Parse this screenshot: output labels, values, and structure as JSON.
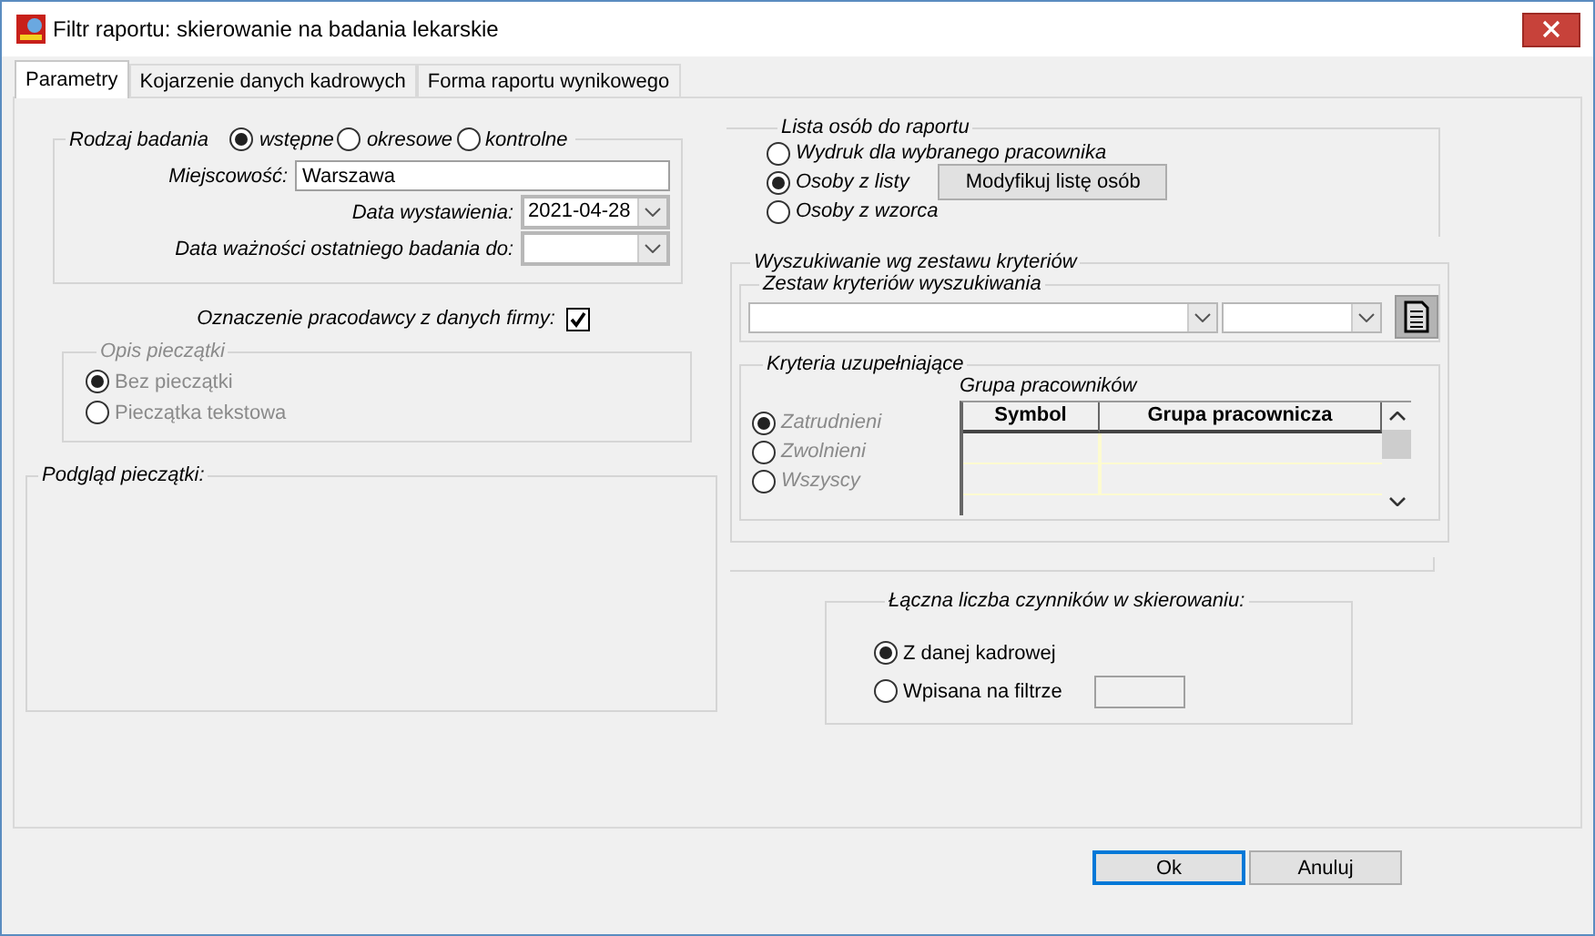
{
  "window": {
    "title": "Filtr raportu: skierowanie na badania lekarskie"
  },
  "tabs": [
    {
      "label": "Parametry",
      "selected": true
    },
    {
      "label": "Kojarzenie danych kadrowych",
      "selected": false
    },
    {
      "label": "Forma raportu wynikowego",
      "selected": false
    }
  ],
  "exam_type": {
    "label": "Rodzaj badania",
    "options": [
      {
        "label": "wstępne",
        "selected": true
      },
      {
        "label": "okresowe",
        "selected": false
      },
      {
        "label": "kontrolne",
        "selected": false
      }
    ]
  },
  "location": {
    "label": "Miejscowość:",
    "value": "Warszawa"
  },
  "issue_date": {
    "label": "Data wystawienia:",
    "value": "2021-04-28"
  },
  "validity_date": {
    "label": "Data ważności ostatniego badania do:"
  },
  "employer_mark": {
    "label": "Oznaczenie pracodawcy z danych firmy:",
    "checked": true
  },
  "stamp_description": {
    "title": "Opis pieczątki",
    "disabled": true,
    "options": [
      {
        "label": "Bez pieczątki",
        "selected": true
      },
      {
        "label": "Pieczątka tekstowa",
        "selected": false
      }
    ]
  },
  "stamp_preview": {
    "title": "Podgląd pieczątki:"
  },
  "person_list": {
    "title": "Lista osób do raportu",
    "modify_button": "Modyfikuj listę osób",
    "options": [
      {
        "label": "Wydruk dla wybranego pracownika",
        "selected": false
      },
      {
        "label": "Osoby z listy",
        "selected": true
      },
      {
        "label": "Osoby z wzorca",
        "selected": false
      }
    ]
  },
  "criteria_search": {
    "title": "Wyszukiwanie wg zestawu kryteriów",
    "set": {
      "title": "Zestaw kryteriów wyszukiwania"
    },
    "supplementary": {
      "title": "Kryteria uzupełniające",
      "disabled": true,
      "options": [
        {
          "label": "Zatrudnieni",
          "selected": true
        },
        {
          "label": "Zwolnieni",
          "selected": false
        },
        {
          "label": "Wszyscy",
          "selected": false
        }
      ],
      "groups_table": {
        "title": "Grupa pracowników",
        "columns": [
          "Symbol",
          "Grupa pracownicza"
        ]
      }
    }
  },
  "factor_count": {
    "title": "Łączna liczba czynników w skierowaniu:",
    "options": [
      {
        "label": "Z danej kadrowej",
        "selected": true
      },
      {
        "label": "Wpisana na filtrze",
        "selected": false
      }
    ]
  },
  "buttons": [
    {
      "label": "Ok",
      "default": true
    },
    {
      "label": "Anuluj",
      "default": false
    }
  ]
}
